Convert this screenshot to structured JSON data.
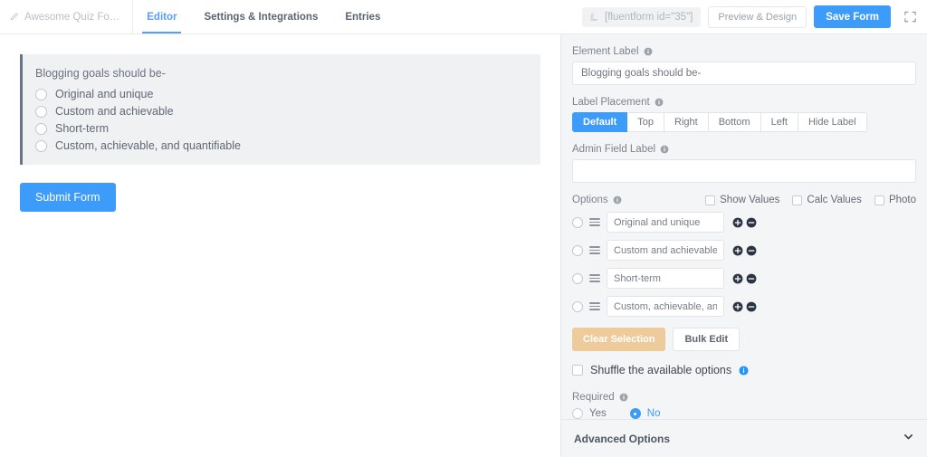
{
  "topbar": {
    "form_name": "Awesome Quiz Fo…",
    "pencil_icon": "pencil-icon",
    "tabs": [
      {
        "label": "Editor",
        "active": true
      },
      {
        "label": "Settings & Integrations",
        "active": false
      },
      {
        "label": "Entries",
        "active": false
      }
    ],
    "shortcode": "[fluentform id=\"35\"]",
    "copy_icon": "copy-icon",
    "preview_label": "Preview & Design",
    "save_label": "Save Form",
    "expand_icon": "expand-icon",
    "accent_color": "#3d9cf9"
  },
  "preview": {
    "field_label": "Blogging goals should be-",
    "options": [
      "Original and unique",
      "Custom and achievable",
      "Short-term",
      "Custom, achievable, and quantifiable"
    ],
    "submit_label": "Submit Form",
    "selected_border_color": "#6a7486",
    "field_bg": "#f0f1f3"
  },
  "settings": {
    "element_label": {
      "title": "Element Label",
      "value": "Blogging goals should be-",
      "info_icon": "info-icon"
    },
    "label_placement": {
      "title": "Label Placement",
      "info_icon": "info-icon",
      "options": [
        "Default",
        "Top",
        "Right",
        "Bottom",
        "Left",
        "Hide Label"
      ],
      "selected": "Default"
    },
    "admin_field_label": {
      "title": "Admin Field Label",
      "value": "",
      "placeholder": "",
      "info_icon": "info-icon"
    },
    "options_section": {
      "title": "Options",
      "info_icon": "info-icon",
      "toggles": [
        {
          "label": "Show Values",
          "checked": false
        },
        {
          "label": "Calc Values",
          "checked": false
        },
        {
          "label": "Photo",
          "checked": false
        }
      ],
      "rows": [
        {
          "value": "Original and unique",
          "selected": false,
          "drag_icon": "drag-handle-icon",
          "add_icon": "plus-circle-icon",
          "remove_icon": "minus-circle-icon"
        },
        {
          "value": "Custom and achievable",
          "selected": false,
          "drag_icon": "drag-handle-icon",
          "add_icon": "plus-circle-icon",
          "remove_icon": "minus-circle-icon"
        },
        {
          "value": "Short-term",
          "selected": false,
          "drag_icon": "drag-handle-icon",
          "add_icon": "plus-circle-icon",
          "remove_icon": "minus-circle-icon"
        },
        {
          "value": "Custom, achievable, and quantifiable",
          "selected": false,
          "drag_icon": "drag-handle-icon",
          "add_icon": "plus-circle-icon",
          "remove_icon": "minus-circle-icon"
        }
      ],
      "clear_selection_label": "Clear Selection",
      "bulk_edit_label": "Bulk Edit",
      "clear_selection_color": "#edcb9a"
    },
    "shuffle": {
      "label": "Shuffle the available options",
      "checked": false,
      "info_icon": "info-icon-blue"
    },
    "required": {
      "title": "Required",
      "info_icon": "info-icon",
      "yes_label": "Yes",
      "no_label": "No",
      "selected": "No"
    },
    "advanced_options": {
      "title": "Advanced Options",
      "chevron_icon": "chevron-down-icon",
      "expanded": false
    }
  }
}
